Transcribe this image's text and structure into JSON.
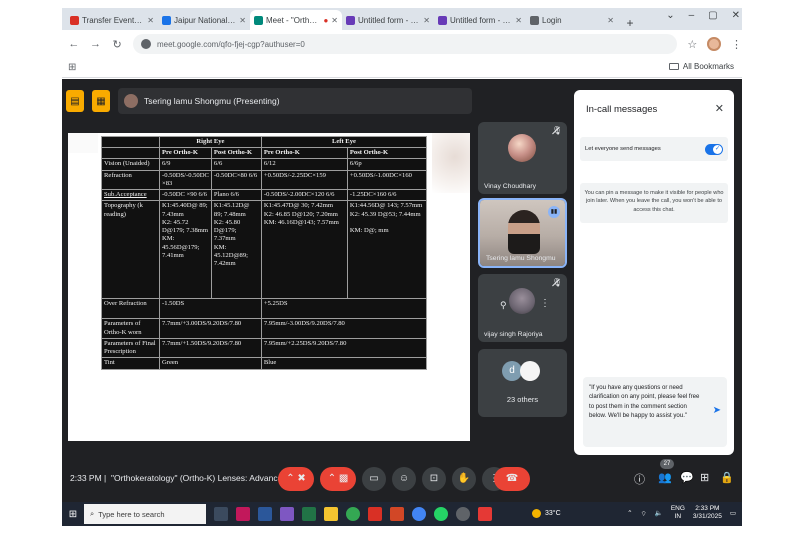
{
  "browser": {
    "tabs": [
      {
        "title": "Transfer Event : Orthokeratolog",
        "color": "#d93025",
        "active": false
      },
      {
        "title": "Jaipur National University",
        "color": "#1a73e8",
        "active": false
      },
      {
        "title": "Meet - \"Orthokeratolog",
        "color": "#00897b",
        "active": true
      },
      {
        "title": "Untitled form - Google Forms",
        "color": "#673ab7",
        "active": false
      },
      {
        "title": "Untitled form - Google Forms",
        "color": "#673ab7",
        "active": false
      },
      {
        "title": "Login",
        "color": "#5f6368",
        "active": false
      }
    ],
    "url": "meet.google.com/qfo-fjej-cgp?authuser=0",
    "all_bookmarks": "All Bookmarks"
  },
  "meet": {
    "presenter_label": "Tsering lamu Shongmu (Presenting)",
    "time": "2:33 PM",
    "meeting_title": "\"Orthokeratology\" (Ortho-K) Lenses: Advance...",
    "participant_count": "27",
    "participants": [
      {
        "name": "Vinay Choudhary"
      },
      {
        "name": "Tsering lamu Shongmu"
      },
      {
        "name": "vijay singh Rajoriya"
      }
    ],
    "others_initial": "d",
    "others_label": "23 others"
  },
  "slide_table": {
    "header": {
      "right_eye": "Right Eye",
      "left_eye": "Left Eye"
    },
    "subheader": [
      "Pre Ortho-K",
      "Post Ortho-K",
      "Pre Ortho-K",
      "Post Ortho-K"
    ],
    "rows": [
      {
        "label": "Vision (Unaided)",
        "cells": [
          "6/9",
          "6/6",
          "6/12",
          "6/6p"
        ]
      },
      {
        "label": "Refraction",
        "cells": [
          "-0.50DS/-0.50DC ×83",
          "-0.50DC×80 6/6",
          "+0.50DS/-2.25DC×159",
          "+0.50DS/-1.00DC×160"
        ]
      },
      {
        "label": "Sub.Acceptance",
        "cells": [
          "-0.50DC ×90 6/6",
          "Plano 6/6",
          "-0.50DS/-2.00DC×120 6/6",
          "-1.25DC×160 6/6"
        ]
      },
      {
        "label": "Topography (k reading)",
        "cells": [
          "K1:45.40D@ 89; 7.43mm\nK2: 45.72 D@179; 7.38mm\nKM: 45.56D@179; 7.41mm",
          "K1:45.12D@ 89; 7.48mm\nK2: 45.80 D@179; 7.37mm\nKM: 45.12D@89; 7.42mm",
          "K1:45.47D@ 30; 7.42mm\nK2: 46.85 D@120; 7.20mm\nKM: 46.16D@143; 7.57mm",
          "K1:44.56D@ 143; 7.57mm\nK2: 45.39 D@53; 7.44mm\n\nKM: D@; mm"
        ]
      },
      {
        "label": "Over Refraction",
        "cells": [
          "-1.50DS",
          "+5.25DS"
        ]
      },
      {
        "label": "Parameters of Ortho-K worn",
        "cells": [
          "7.7mm/+3.00DS/9.20DS/7.80",
          "7.95mm/-3.00DS/9.20DS/7.80"
        ]
      },
      {
        "label": "Parameters of Final Prescription",
        "cells": [
          "7.7mm/+1.50DS/9.20DS/7.80",
          "7.95mm/+2.25DS/9.20DS/7.80"
        ]
      },
      {
        "label": "Tint",
        "cells": [
          "Green",
          "Blue"
        ]
      }
    ]
  },
  "chat_panel": {
    "title": "In-call messages",
    "allow_label": "Let everyone send messages",
    "allow_enabled": true,
    "info_text": "You can pin a message to make it visible for people who join later. When you leave the call, you won't be able to access this chat.",
    "message_text": "\"If you have any questions or need clarification on any point, please feel free to post them in the comment section below. We'll be happy to assist you.\""
  },
  "taskbar": {
    "search_placeholder": "Type here to search",
    "temperature": "33°C",
    "language": "ENG",
    "region": "IN",
    "time": "2:33 PM",
    "date": "3/31/2025"
  }
}
